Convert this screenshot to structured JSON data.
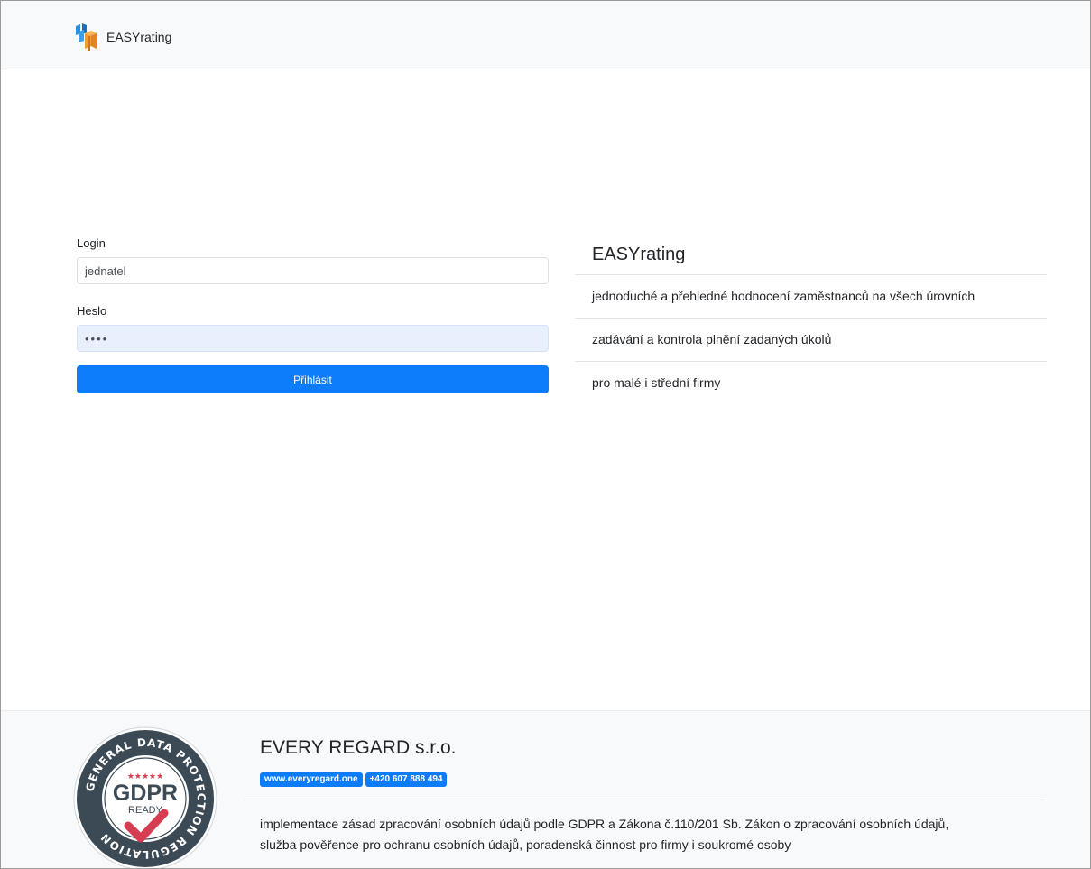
{
  "navbar": {
    "brand_name": "EASYrating",
    "logo_icon": "stacked-blocks-logo-icon"
  },
  "login_form": {
    "login_label": "Login",
    "login_value": "jednatel",
    "password_label": "Heslo",
    "password_value": "••••",
    "submit_label": "Přihlásit"
  },
  "features": {
    "title": "EASYrating",
    "items": [
      "jednoduché a přehledné hodnocení zaměstnanců na všech úrovních",
      "zadávání a kontrola plnění zadaných úkolů",
      "pro malé i střední firmy"
    ]
  },
  "footer": {
    "company": "EVERY REGARD s.r.o.",
    "website": "www.everyregard.one",
    "phone": "+420 607 888 494",
    "description_line1": "implementace zásad zpracování osobních údajů podle GDPR a Zákona č.110/201 Sb. Zákon o zpracování osobních údajů,",
    "description_line2": "služba pověřence pro ochranu osobních údajů, poradenská činnost pro firmy i soukromé osoby",
    "seal": {
      "ring_text_top": "GENERAL DATA PROTECTION REGULATION",
      "stars": "★★★★★",
      "main": "GDPR",
      "sub": "READY"
    }
  },
  "colors": {
    "accent": "#0d7cfb",
    "navbar_bg": "#f8f9fa",
    "autofill_bg": "#e8f0fe",
    "seal_dark": "#3c4a55",
    "seal_red": "#d63d50"
  }
}
